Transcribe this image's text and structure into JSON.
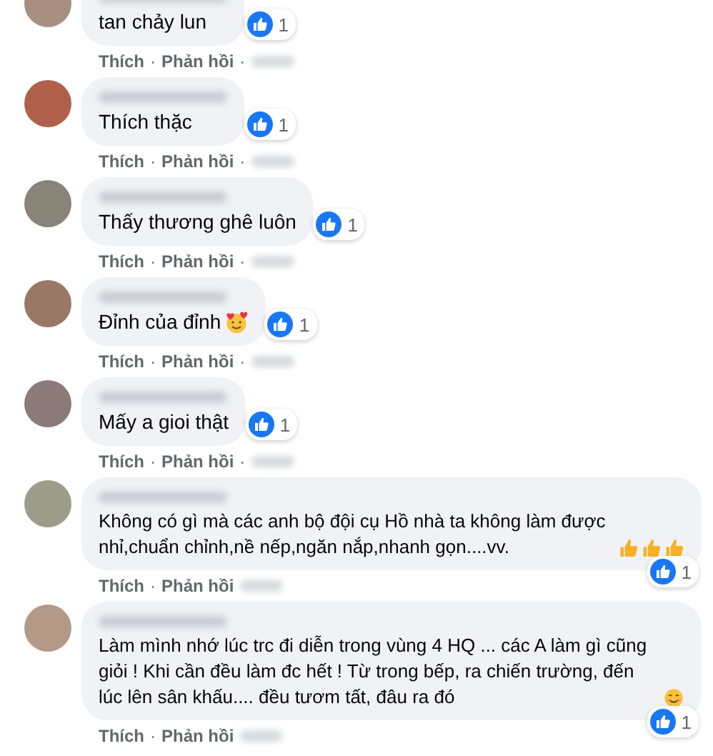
{
  "comments": [
    {
      "color": "#a89080",
      "body": "tan chảy lun",
      "kind": "short",
      "likes": "1",
      "actions": {
        "like": "Thích",
        "separator": "·",
        "reply": "Phản hồi",
        "separator_2": "·"
      }
    },
    {
      "color": "#b0604a",
      "body": "Thích thặc",
      "kind": "short",
      "likes": "1",
      "actions": {
        "like": "Thích",
        "separator": "·",
        "reply": "Phản hồi",
        "separator_2": "·"
      }
    },
    {
      "color": "#8a8478",
      "body": "Thấy thương ghê luôn",
      "kind": "short",
      "likes": "1",
      "actions": {
        "like": "Thích",
        "separator": "·",
        "reply": "Phản hồi",
        "separator_2": "·"
      }
    },
    {
      "color": "#9a7868",
      "body": "Đỉnh của đỉnh",
      "emojis": [
        {
          "kind": "hearts"
        }
      ],
      "kind": "short",
      "likes": "1",
      "actions": {
        "like": "Thích",
        "separator": "·",
        "reply": "Phản hồi",
        "separator_2": "·"
      }
    },
    {
      "color": "#8c7a7a",
      "body": "Mấy a gioi thật",
      "kind": "short",
      "likes": "1",
      "actions": {
        "like": "Thích",
        "separator": "·",
        "reply": "Phản hồi",
        "separator_2": "·"
      }
    },
    {
      "color": "#9c9c88",
      "body": "Không có gì mà các anh bộ đội cụ Hồ nhà ta không làm được nhỉ,chuẩn chỉnh,nề nếp,ngăn nắp,nhanh gọn....vv.",
      "emojis": [
        {
          "kind": "thumbs"
        },
        {
          "kind": "thumbs"
        },
        {
          "kind": "thumbs"
        }
      ],
      "kind": "long",
      "likes": "1",
      "actions": {
        "like": "Thích",
        "separator": "·",
        "reply": "Phản hồi"
      }
    },
    {
      "color": "#b49888",
      "body": "Làm mình nhớ lúc trc đi diễn trong vùng 4 HQ ... các A làm gì cũng giỏi ! Khi cần đều làm đc hết ! Từ trong bếp, ra chiến trường, đến lúc lên sân khấu.... đều tươm tất, đâu ra đó",
      "emojis": [
        {
          "kind": "smile"
        }
      ],
      "kind": "long",
      "likes": "1",
      "actions": {
        "like": "Thích",
        "separator": "·",
        "reply": "Phản hồi"
      }
    }
  ]
}
